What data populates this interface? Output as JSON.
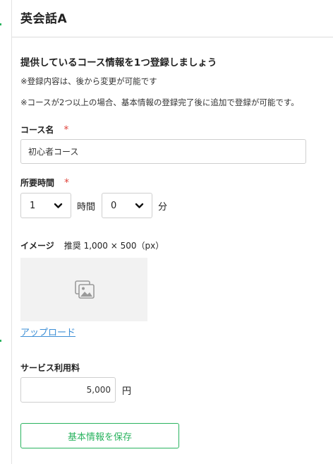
{
  "header": {
    "title": "英会話A"
  },
  "intro": {
    "title": "提供しているコース情報を1つ登録しましょう",
    "note1": "※登録内容は、後から変更が可能です",
    "note2": "※コースが2つ以上の場合、基本情報の登録完了後に追加で登録が可能です。"
  },
  "course_name": {
    "label": "コース名",
    "required_mark": "*",
    "value": "初心者コース"
  },
  "duration": {
    "label": "所要時間",
    "required_mark": "*",
    "hours_value": "1",
    "hours_unit": "時間",
    "minutes_value": "0",
    "minutes_unit": "分"
  },
  "image": {
    "label": "イメージ",
    "recommend": "推奨 1,000 × 500（px）",
    "placeholder_icon": "image-placeholder-icon",
    "upload_label": "アップロード"
  },
  "fee": {
    "label": "サービス利用料",
    "value": "5,000",
    "currency": "円"
  },
  "save_button": {
    "label": "基本情報を保存"
  },
  "colors": {
    "accent": "#2ab35f",
    "required": "#e0443c",
    "link": "#3d8fd6"
  }
}
